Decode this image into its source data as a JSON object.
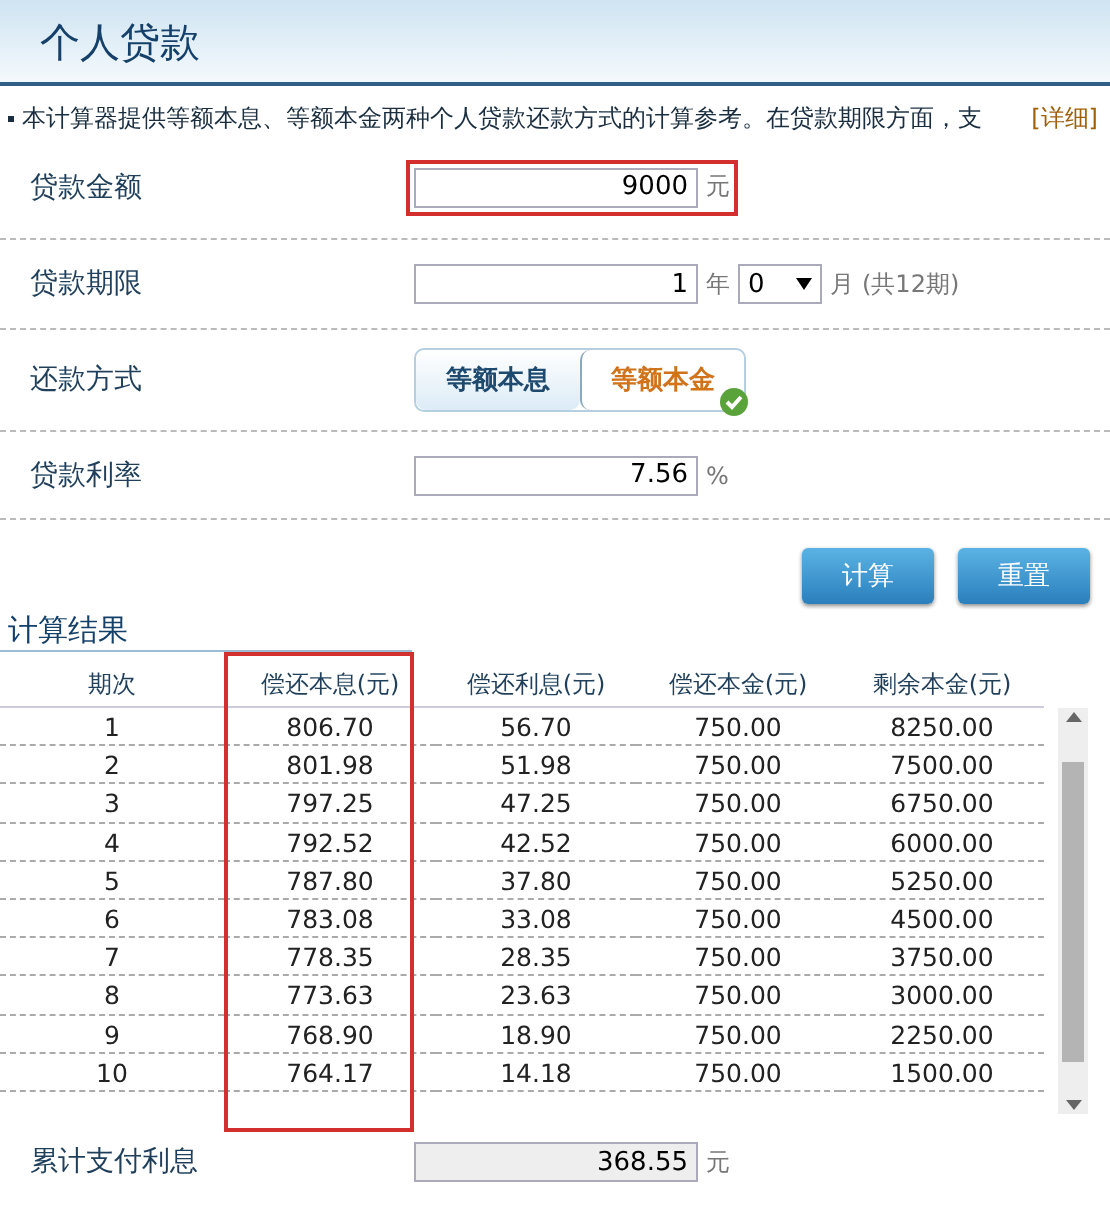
{
  "title": "个人贷款",
  "intro": {
    "text": "本计算器提供等额本息、等额本金两种个人贷款还款方式的计算参考。在贷款期限方面，支",
    "link": "[详细]"
  },
  "amount": {
    "label": "贷款金额",
    "value": "9000",
    "unit": "元",
    "highlighted": true
  },
  "term": {
    "label": "贷款期限",
    "years": "1",
    "year_unit": "年",
    "months": "0",
    "month_unit": "月",
    "periods": "(共12期)"
  },
  "method": {
    "label": "还款方式",
    "options": [
      {
        "label": "等额本息",
        "selected": false
      },
      {
        "label": "等额本金",
        "selected": true
      }
    ]
  },
  "rate": {
    "label": "贷款利率",
    "value": "7.56",
    "unit": "%"
  },
  "buttons": [
    "计算",
    "重置"
  ],
  "results": {
    "title": "计算结果",
    "columns": [
      {
        "label": "期次",
        "highlighted": false
      },
      {
        "label": "偿还本息(元)",
        "highlighted": true
      },
      {
        "label": "偿还利息(元)",
        "highlighted": false
      },
      {
        "label": "偿还本金(元)",
        "highlighted": false
      },
      {
        "label": "剩余本金(元)",
        "highlighted": false
      }
    ],
    "rows": [
      [
        "1",
        "806.70",
        "56.70",
        "750.00",
        "8250.00"
      ],
      [
        "2",
        "801.98",
        "51.98",
        "750.00",
        "7500.00"
      ],
      [
        "3",
        "797.25",
        "47.25",
        "750.00",
        "6750.00"
      ],
      [
        "4",
        "792.52",
        "42.52",
        "750.00",
        "6000.00"
      ],
      [
        "5",
        "787.80",
        "37.80",
        "750.00",
        "5250.00"
      ],
      [
        "6",
        "783.08",
        "33.08",
        "750.00",
        "4500.00"
      ],
      [
        "7",
        "778.35",
        "28.35",
        "750.00",
        "3750.00"
      ],
      [
        "8",
        "773.63",
        "23.63",
        "750.00",
        "3000.00"
      ],
      [
        "9",
        "768.90",
        "18.90",
        "750.00",
        "2250.00"
      ],
      [
        "10",
        "764.17",
        "14.18",
        "750.00",
        "1500.00"
      ]
    ]
  },
  "total_interest": {
    "label": "累计支付利息",
    "value": "368.55",
    "unit": "元"
  }
}
